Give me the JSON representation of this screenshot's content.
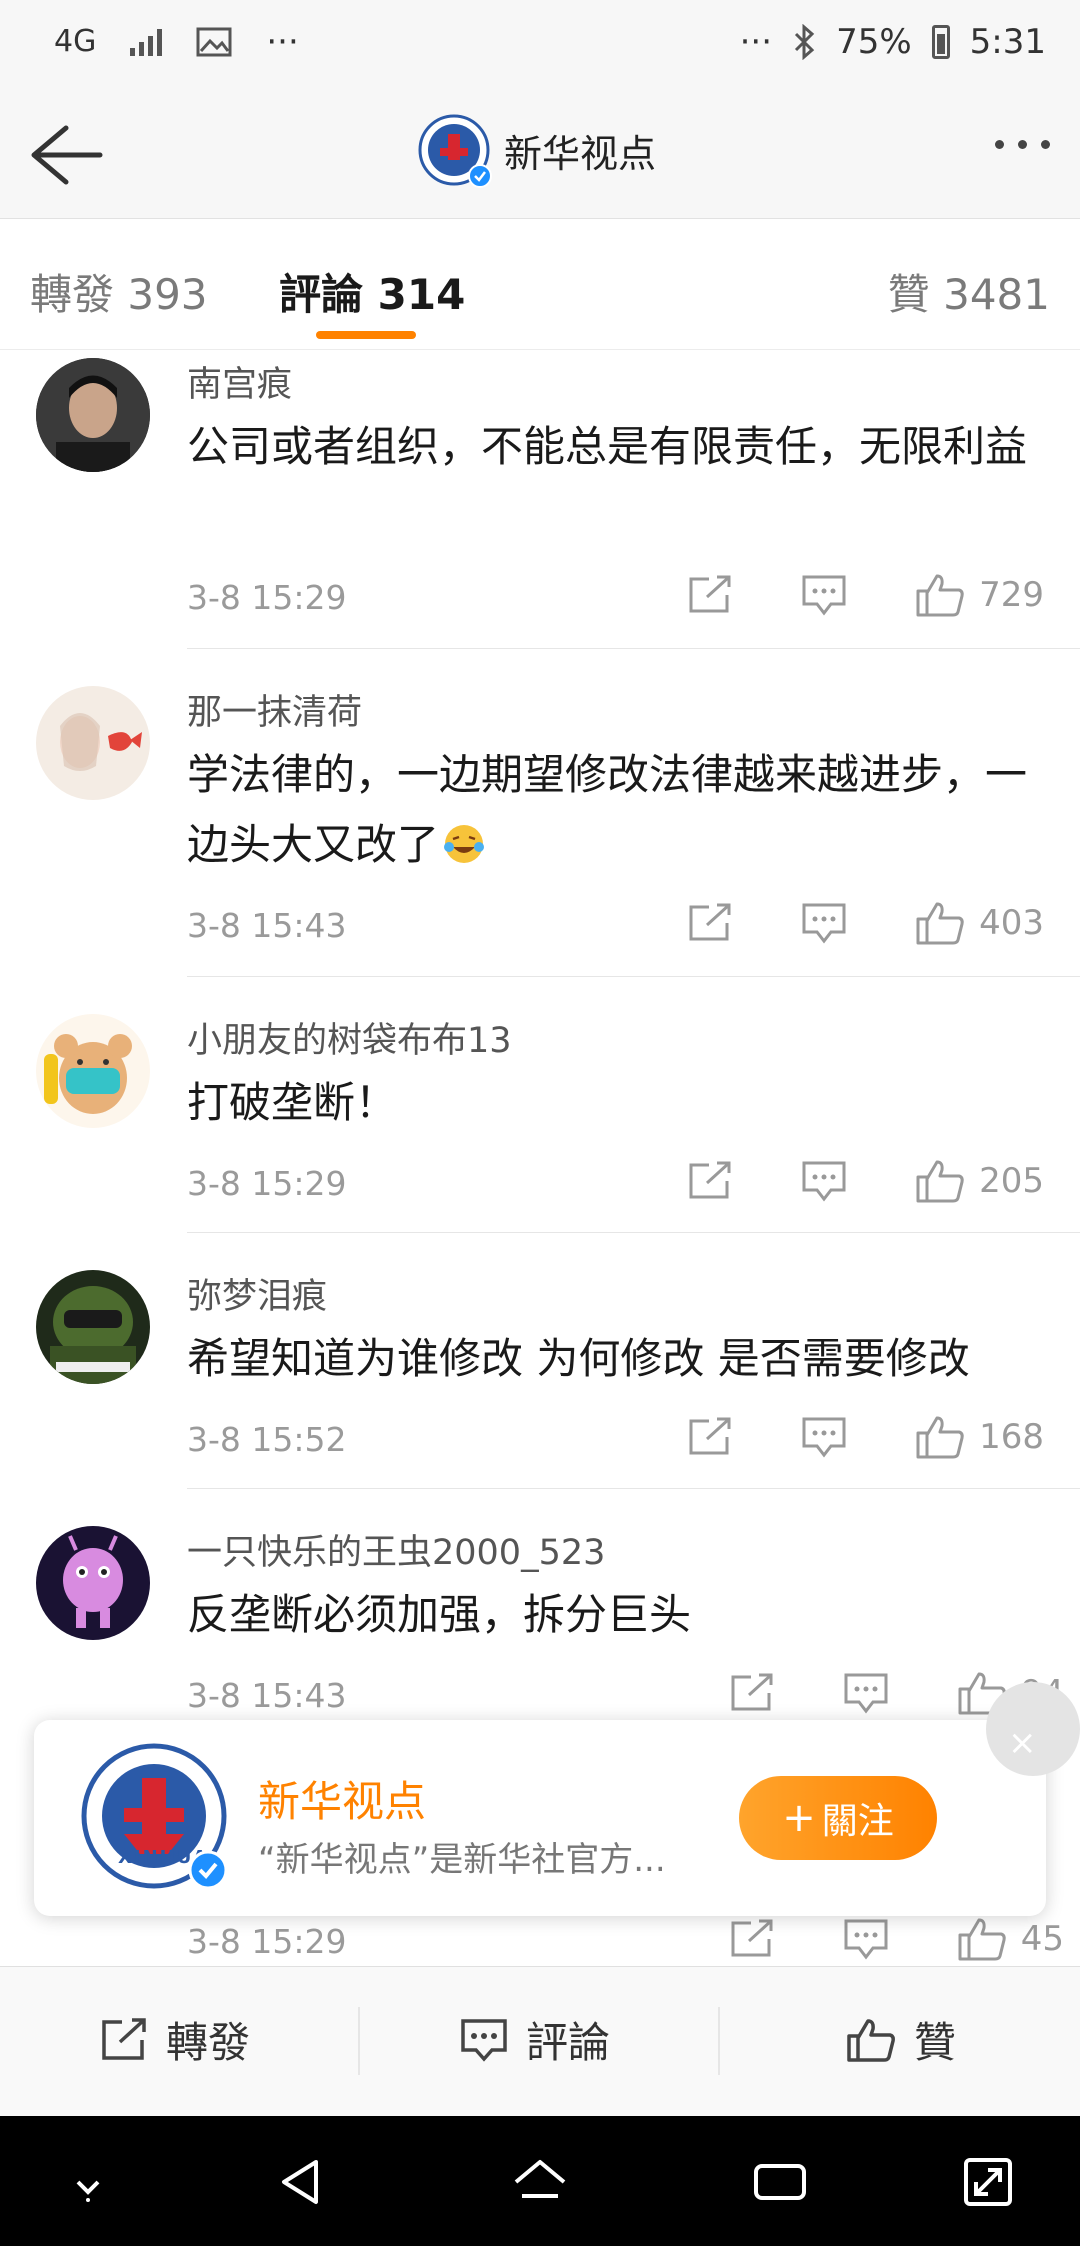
{
  "status_bar": {
    "network": "4G",
    "overflow_left": "···",
    "overflow_right": "···",
    "battery": "75%",
    "time": "5:31"
  },
  "nav": {
    "title": "新华视点",
    "avatar_caption": "XINHUA"
  },
  "tabs": [
    {
      "label": "轉發 393",
      "active": false
    },
    {
      "label": "評論 314",
      "active": true
    },
    {
      "label": "贊 3481",
      "active": false
    }
  ],
  "comments": [
    {
      "user": "南宫痕",
      "text": "公司或者组织，不能总是有限责任，无限利益",
      "time": "3-8 15:29",
      "likes": "729"
    },
    {
      "user": "那一抹清荷",
      "text": "学法律的，一边期望修改法律越来越进步，一边头大又改了",
      "time": "3-8 15:43",
      "likes": "403"
    },
    {
      "user": "小朋友的树袋布布13",
      "text": "打破垄断！",
      "time": "3-8 15:29",
      "likes": "205"
    },
    {
      "user": "弥梦泪痕",
      "text": "希望知道为谁修改 为何修改 是否需要修改",
      "time": "3-8 15:52",
      "likes": "168"
    },
    {
      "user": "一只快乐的王虫2000_523",
      "text": "反垄断必须加强，拆分巨头",
      "time": "3-8 15:43",
      "likes": "94"
    },
    {
      "user": "",
      "text": "",
      "time": "3-8 15:29",
      "likes": "45"
    }
  ],
  "follow_card": {
    "name": "新华视点",
    "description": "“新华视点”是新华社官方...",
    "follow_label": "關注",
    "close": "×"
  },
  "action_bar": {
    "repost": "轉發",
    "comment": "評論",
    "like": "贊"
  },
  "colors": {
    "accent": "#ff8200",
    "verified": "#1e90ff"
  }
}
